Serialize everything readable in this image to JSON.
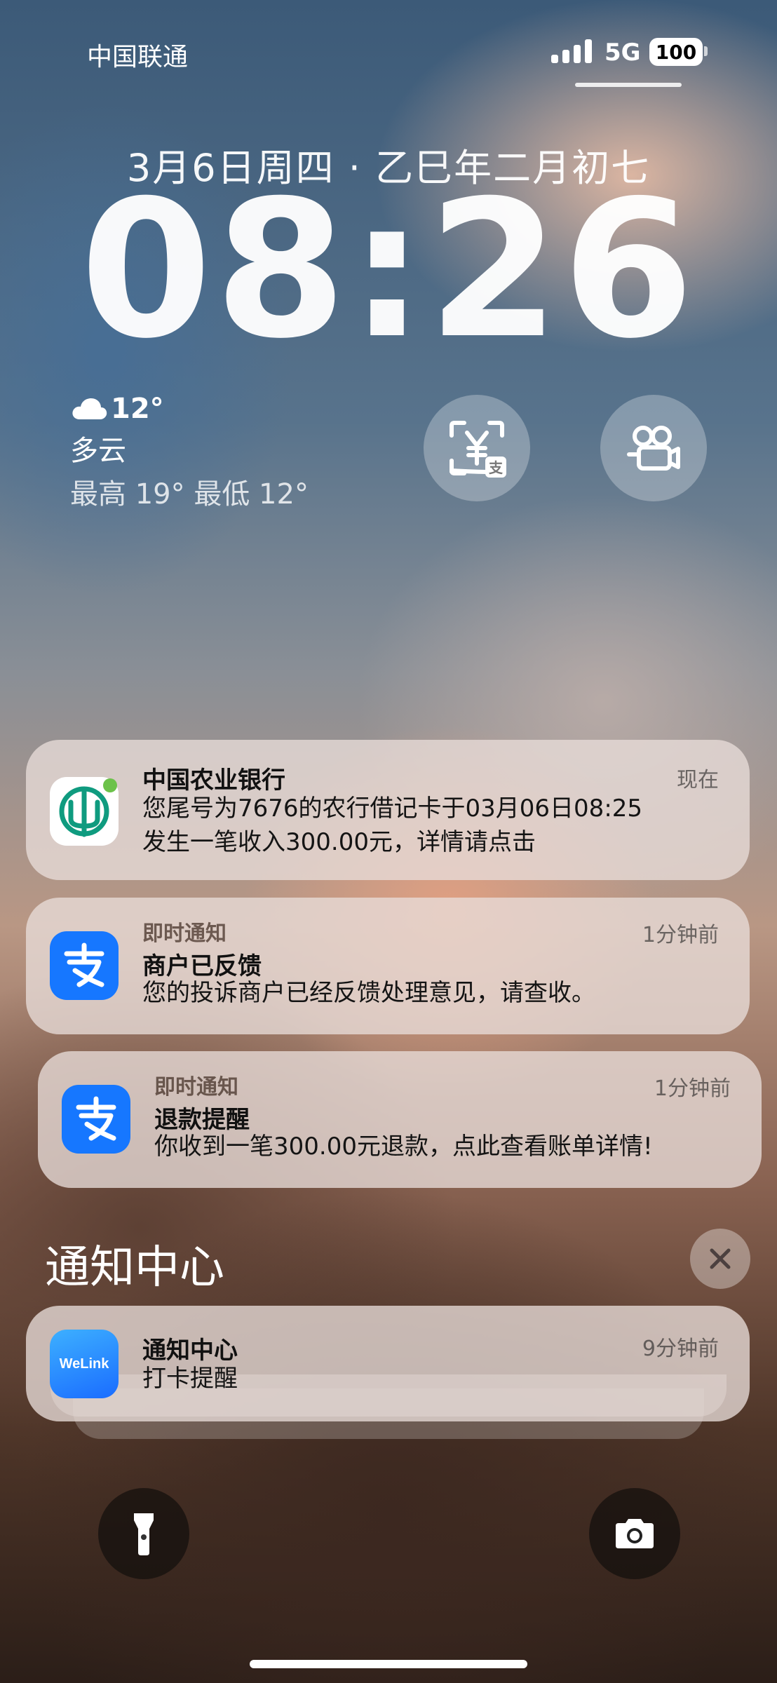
{
  "status_bar": {
    "carrier": "中国联通",
    "network": "5G",
    "battery": "100"
  },
  "lock_screen": {
    "date": "3月6日周四 · 乙巳年二月初七",
    "time": "08:26"
  },
  "weather": {
    "temperature": "12°",
    "condition": "多云",
    "range": "最高 19° 最低 12°",
    "icon": "cloud-icon"
  },
  "widgets": [
    {
      "name": "alipay-payment-widget",
      "icon": "yuan-pay-icon"
    },
    {
      "name": "video-widget",
      "icon": "video-camera-icon"
    }
  ],
  "notifications": [
    {
      "app_icon": "abc-bank-icon",
      "title": "中国农业银行",
      "time": "现在",
      "body_line1": "您尾号为7676的农行借记卡于03月06日08:25",
      "body_line2": "发生一笔收入300.00元，详情请点击"
    },
    {
      "app_icon": "alipay-icon",
      "subtitle": "即时通知",
      "title": "商户已反馈",
      "time": "1分钟前",
      "body": "您的投诉商户已经反馈处理意见，请查收。"
    },
    {
      "app_icon": "alipay-icon",
      "subtitle": "即时通知",
      "title": "退款提醒",
      "time": "1分钟前",
      "body": "你收到一笔300.00元退款，点此查看账单详情!"
    }
  ],
  "notification_center": {
    "title": "通知中心",
    "close_icon": "close-icon",
    "group": {
      "app_icon_text": "WeLink",
      "title": "通知中心",
      "time": "9分钟前",
      "body": "打卡提醒"
    }
  },
  "colors": {
    "alipay_blue": "#1677ff",
    "abc_green": "#0f9b7f",
    "welink_blue": "#1a8cff"
  },
  "bottom_controls": {
    "left_icon": "flashlight-icon",
    "right_icon": "camera-icon"
  }
}
